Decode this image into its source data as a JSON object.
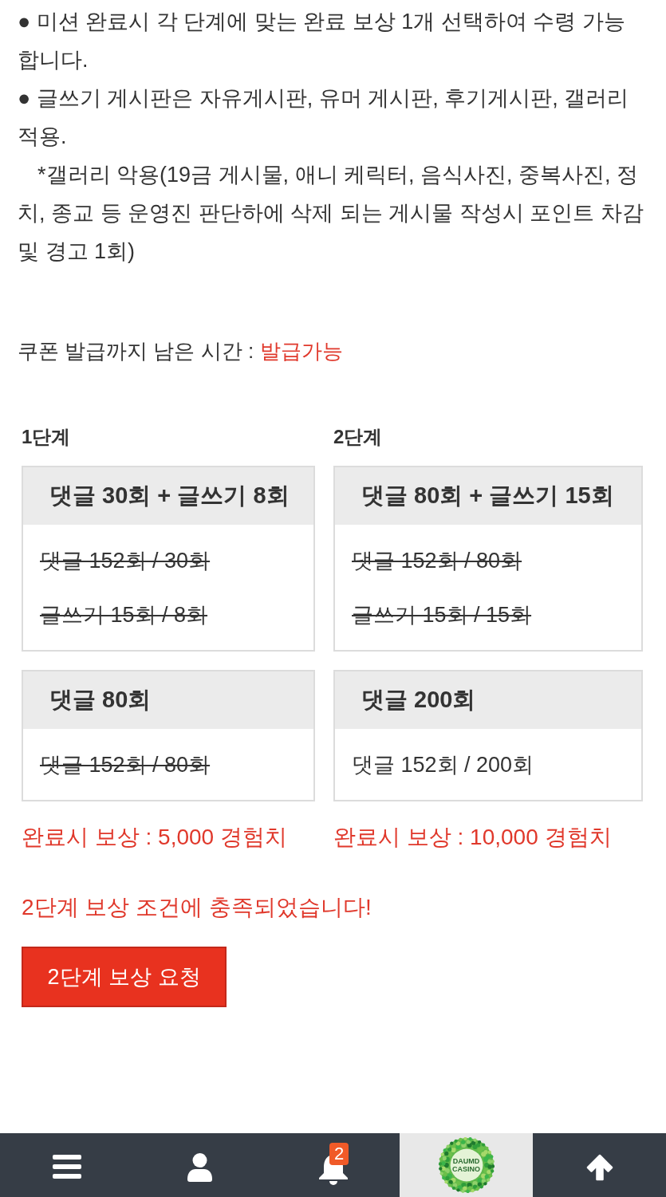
{
  "notice": [
    {
      "kind": "bullet",
      "text": "● 미션 완료시 각 단계에 맞는 완료 보상 1개 선택하여 수령 가능 합니다."
    },
    {
      "kind": "bullet",
      "text": "● 글쓰기 게시판은 자유게시판, 유머 게시판, 후기게시판, 갤러리 적용."
    },
    {
      "kind": "note",
      "text": "*갤러리 악용(19금 게시물, 애니 케릭터, 음식사진, 중복사진, 정치, 종교 등 운영진 판단하에 삭제 되는 게시물 작성시 포인트 차감 및 경고 1회)"
    }
  ],
  "coupon": {
    "label": "쿠폰 발급까지 남은 시간 :",
    "status": "발급가능"
  },
  "stages": [
    {
      "label": "1단계",
      "missions": [
        {
          "title": "댓글 30회 + 글쓰기 8회",
          "criteria": [
            {
              "text": "댓글 152회 / 30회",
              "completed": true
            },
            {
              "text": "글쓰기 15회 / 8회",
              "completed": true
            }
          ]
        },
        {
          "title": "댓글 80회",
          "criteria": [
            {
              "text": "댓글 152회 / 80회",
              "completed": true
            }
          ]
        }
      ],
      "reward": "완료시 보상 : 5,000 경험치"
    },
    {
      "label": "2단계",
      "missions": [
        {
          "title": "댓글 80회 + 글쓰기 15회",
          "criteria": [
            {
              "text": "댓글 152회 / 80회",
              "completed": true
            },
            {
              "text": "글쓰기 15회 / 15회",
              "completed": true
            }
          ]
        },
        {
          "title": "댓글 200회",
          "criteria": [
            {
              "text": "댓글 152회 / 200회",
              "completed": false
            }
          ]
        }
      ],
      "reward": "완료시 보상 : 10,000 경험치"
    }
  ],
  "status_message": "2단계 보상 조건에 충족되었습니다!",
  "request_button": "2단계 보상 요청",
  "bottom_nav": [
    {
      "kind": "menu"
    },
    {
      "kind": "profile"
    },
    {
      "kind": "notifications",
      "badge": "2"
    },
    {
      "kind": "home",
      "logo_text": [
        "DAUMD",
        "CASINO"
      ]
    },
    {
      "kind": "top"
    }
  ]
}
